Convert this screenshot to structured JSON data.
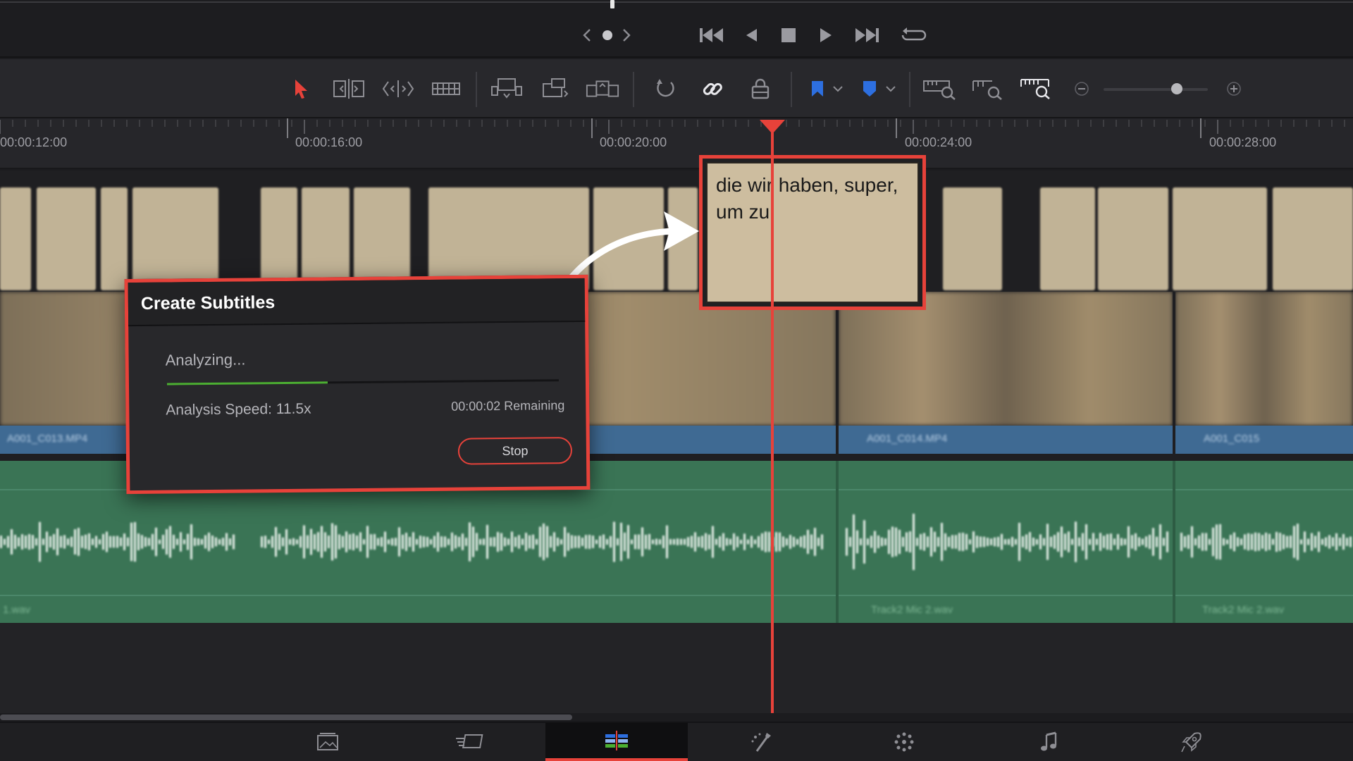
{
  "colors": {
    "accent": "#e7423a",
    "subtitle_clip": "#cfc0a0",
    "video_bar": "#3f6a93",
    "audio_track": "#3a7455",
    "progress": "#4caf32",
    "marker_blue": "#2d6fe0"
  },
  "transport": {
    "icons": [
      "chevron-left-icon",
      "dot-icon",
      "chevron-right-icon",
      "skip-to-start-icon",
      "step-back-icon",
      "stop-icon",
      "play-icon",
      "skip-to-end-icon",
      "loop-icon"
    ]
  },
  "toolbar": {
    "icons": [
      "selection-arrow-icon",
      "trim-edit-icon",
      "dynamic-trim-icon",
      "blade-icon",
      "insert-clip-icon",
      "overwrite-clip-icon",
      "replace-clip-icon",
      "snapping-icon",
      "linked-selection-icon",
      "position-lock-icon",
      "flag-icon",
      "marker-icon",
      "zoom-full-icon",
      "zoom-detail-icon",
      "zoom-custom-icon",
      "zoom-out-icon",
      "zoom-in-icon"
    ],
    "zoom_level": 0.7
  },
  "ruler": {
    "timecodes": [
      "00:00:12:00",
      "00:00:16:00",
      "00:00:20:00",
      "00:00:24:00",
      "00:00:28:00"
    ]
  },
  "callout": {
    "subtitle_text": "die wir haben, super, um zu"
  },
  "dialog": {
    "title": "Create Subtitles",
    "status": "Analyzing...",
    "progress": 0.41,
    "speed": "Analysis Speed: 11.5x",
    "remaining": "00:00:02 Remaining",
    "stop_label": "Stop"
  },
  "page_nav": {
    "pages": [
      "media-page-icon",
      "cut-page-icon",
      "edit-page-icon",
      "fusion-page-icon",
      "color-page-icon",
      "fairlight-page-icon",
      "deliver-page-icon"
    ],
    "active_index": 2
  }
}
